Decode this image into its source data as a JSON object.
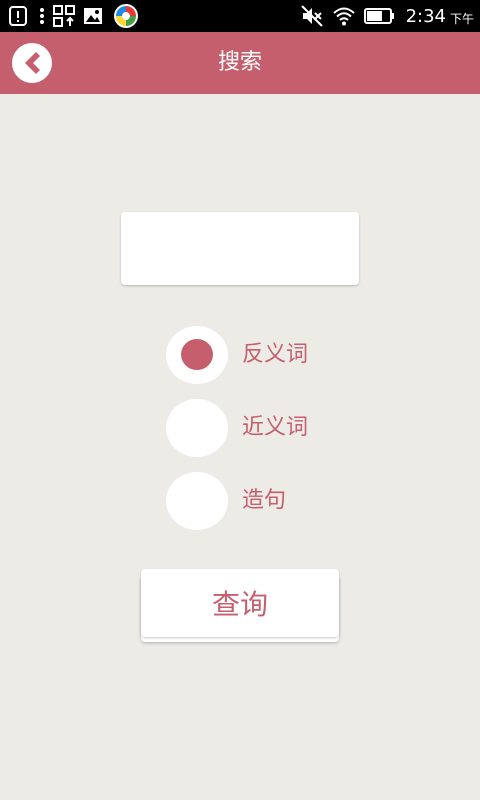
{
  "status_bar": {
    "time": "2:34",
    "ampm": "下午",
    "left_icons": [
      "alert-icon",
      "more-icon",
      "qr-upload-icon",
      "image-icon",
      "app-icon"
    ],
    "right_icons": [
      "mute-icon",
      "wifi-icon",
      "battery-icon"
    ]
  },
  "header": {
    "title": "搜索",
    "back_icon": "chevron-left-icon"
  },
  "search": {
    "value": "",
    "placeholder": ""
  },
  "options": [
    {
      "label": "反义词",
      "selected": true
    },
    {
      "label": "近义词",
      "selected": false
    },
    {
      "label": "造句",
      "selected": false
    }
  ],
  "query_button": {
    "label": "查询"
  },
  "colors": {
    "accent": "#c55f6e",
    "background": "#ecebe6",
    "status_bar": "#000000",
    "surface": "#ffffff"
  }
}
